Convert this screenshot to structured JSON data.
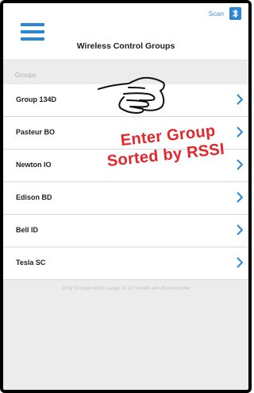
{
  "header": {
    "title": "Wireless Control Groups",
    "scan_label": "Scan",
    "menu_icon": "hamburger-menu-icon",
    "bluetooth_icon": "bluetooth-icon"
  },
  "section": {
    "label": "Groups"
  },
  "groups": [
    {
      "label": "Group 134D"
    },
    {
      "label": "Pasteur BO"
    },
    {
      "label": "Newton IO"
    },
    {
      "label": "Edison BD"
    },
    {
      "label": "Bell ID"
    },
    {
      "label": "Tesla SC"
    }
  ],
  "footer_note": "Only Groups within range of 10 meters are discoverable",
  "annotation": {
    "line1": "Enter Group",
    "line2": "Sorted by RSSI",
    "pointer_icon": "pointing-hand-icon"
  },
  "colors": {
    "accent": "#2a87d8",
    "annotation": "#e4262b"
  }
}
